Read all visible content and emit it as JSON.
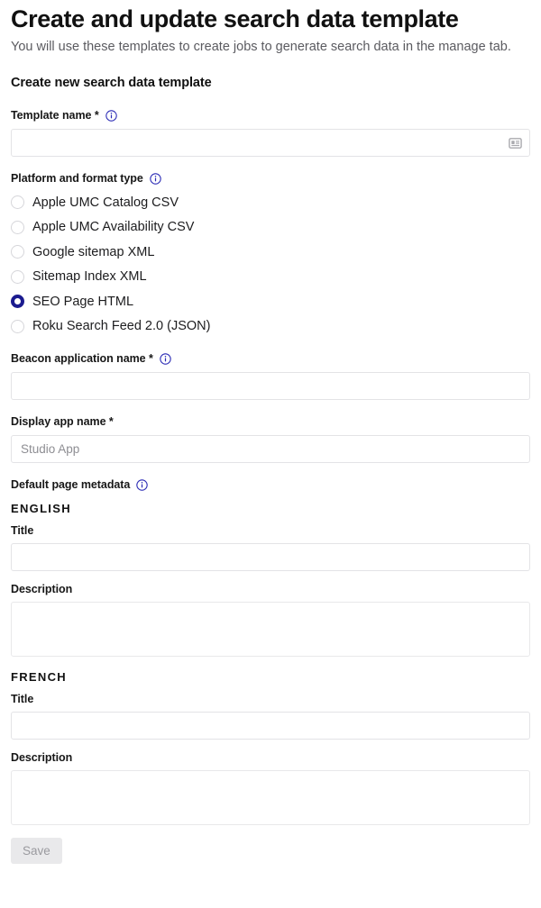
{
  "header": {
    "title": "Create and update search data template",
    "subtitle": "You will use these templates to create jobs to generate search data in the manage tab.",
    "section_heading": "Create new search data template"
  },
  "template_name": {
    "label": "Template name *",
    "info_icon": "info-icon",
    "value": "",
    "placeholder": "",
    "trailing_icon": "contact-card-icon"
  },
  "platform_format": {
    "label": "Platform and format type",
    "info_icon": "info-icon",
    "selected": "SEO Page HTML",
    "options": [
      {
        "label": "Apple UMC Catalog CSV",
        "selected": false
      },
      {
        "label": "Apple UMC Availability CSV",
        "selected": false
      },
      {
        "label": "Google sitemap XML",
        "selected": false
      },
      {
        "label": "Sitemap Index XML",
        "selected": false
      },
      {
        "label": "SEO Page HTML",
        "selected": true
      },
      {
        "label": "Roku Search Feed 2.0 (JSON)",
        "selected": false
      }
    ]
  },
  "beacon_application_name": {
    "label": "Beacon application name *",
    "info_icon": "info-icon",
    "value": "",
    "placeholder": ""
  },
  "display_app_name": {
    "label": "Display app name *",
    "value": "",
    "placeholder": "Studio App"
  },
  "default_page_metadata": {
    "label": "Default page metadata",
    "info_icon": "info-icon",
    "locales": [
      {
        "name": "ENGLISH",
        "title_label": "Title",
        "title_value": "",
        "description_label": "Description",
        "description_value": ""
      },
      {
        "name": "FRENCH",
        "title_label": "Title",
        "title_value": "",
        "description_label": "Description",
        "description_value": ""
      }
    ]
  },
  "footer": {
    "save_label": "Save",
    "save_disabled": true
  },
  "colors": {
    "accent": "#1b1b8f",
    "info_icon": "#2b2bb5",
    "text": "#141414",
    "muted_text": "#5b5b60",
    "placeholder": "#8e8e93",
    "border": "#e3e3e6",
    "disabled_bg": "#e9e9eb",
    "disabled_text": "#9a9a9f"
  }
}
